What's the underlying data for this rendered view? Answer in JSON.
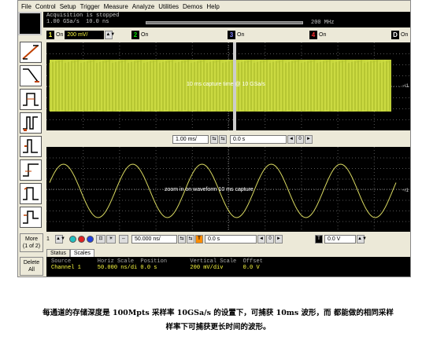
{
  "menu": [
    "File",
    "Control",
    "Setup",
    "Trigger",
    "Measure",
    "Analyze",
    "Utilities",
    "Demos",
    "Help"
  ],
  "acquisition": {
    "status": "Acquisition is stopped",
    "sample_rate": "1.00 GSa/s",
    "time_per_div": "10.0 ns",
    "bandwidth": "200 MHz"
  },
  "channels": [
    {
      "num": "1",
      "state": "On",
      "scale": "200 mV/",
      "color": "#ffff00"
    },
    {
      "num": "2",
      "state": "On",
      "color": "#00c000"
    },
    {
      "num": "3",
      "state": "On",
      "color": "#4040ff"
    },
    {
      "num": "4",
      "state": "On",
      "color": "#ff2020"
    },
    {
      "num": "D",
      "state": "On",
      "color": "#303030"
    }
  ],
  "main_screen": {
    "annotation": "10 ms capture time @ 10 GSa/s",
    "waveform_color": "#c4d43a"
  },
  "main_timebase": {
    "scale": "1.00 ms/",
    "position": "0.0 s"
  },
  "zoom_screen": {
    "annotation": "zoom in on waveform 10 ms capture",
    "waveform_color": "#d8d860"
  },
  "bottom_controls": {
    "channel": "1",
    "zoom_scale": "50.000 ns/",
    "zoom_position": "0.0 s",
    "trigger_label": "T",
    "trigger_level": "0.0 V"
  },
  "left_buttons": {
    "more": "More",
    "more_sub": "(1 of 2)",
    "delete": "Delete",
    "delete_sub": "All"
  },
  "tabs": [
    "Status",
    "Scales"
  ],
  "scales_table": {
    "header": "Source        Horiz Scale  Position       Vertical Scale  Offset",
    "row": "Channel 1     50.000 ns/di 0.0 s          200 mV/div      0.0 V"
  },
  "caption": {
    "line1": "每通道的存储深度是 100Mpts 采样率 10GSa/s 的设置下，可捕获 10ms 波形，而 都能做的相同采样",
    "line2": "样率下可捕获更长时间的波形。"
  }
}
